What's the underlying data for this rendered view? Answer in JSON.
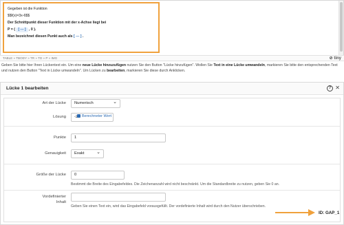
{
  "editor": {
    "line1": "Gegeben ist die Funktion",
    "line2": "$$f(x)=3x-6$$",
    "line3": "Der Schnittpunkt dieser Funktion mit der x-Achse liegt bei",
    "line4_prefix": "P = (",
    "line4_gap": "[ --- ]",
    "line4_suffix": ", 0 ).",
    "line5_prefix": "Man bezeichnet diesen Punkt auch als",
    "line5_gap": "[ --- ]",
    "line5_suffix": "."
  },
  "statusbar": {
    "path": "TABLE » TBODY » TR » TD » P » IMG",
    "brand": "tiny"
  },
  "help": {
    "text_a": "Geben Sie bitte hier Ihren Lückentext ein. Um eine ",
    "text_b": "neue Lücke hinzuzufügen",
    "text_c": " nutzen Sie den Button \"Lücke hinzufügen\". Wollen Sie ",
    "text_d": "Text in eine Lücke umwandeln",
    "text_e": ", markieren Sie bitte den entsprechenden Text und nutzen den Button \"Text in Lücke umwandeln\". Um Lücken zu ",
    "text_f": "bearbeiten",
    "text_g": ", markieren Sie diese durch Anklicken."
  },
  "panel": {
    "title": "Lücke 1 bearbeiten",
    "help_icon": "?",
    "close_icon": "✕"
  },
  "form": {
    "gap_type_label": "Art der Lücke",
    "gap_type_value": "Numerisch",
    "solution_label": "Lösung",
    "solution_value": "-2",
    "calc_link": "Berechneter Wert",
    "points_label": "Punkte",
    "points_value": "1",
    "precision_label": "Genauigkeit",
    "precision_value": "Exakt",
    "size_label": "Größe der Lücke",
    "size_value": "0",
    "size_hint": "Bestimmt die Breite des Eingabefeldes. Die Zeichenanzahl wird nicht beschränkt. Um die Standardbreite zu nutzen, geben Sie 0 an.",
    "predef_label_1": "Vordefinierter",
    "predef_label_2": "Inhalt",
    "predef_value": "",
    "predef_hint": "Geben Sie einen Text ein, wird das Eingabefeld vorausgefüllt. Der vordefinierte Inhalt wird durch den Nutzer überschrieben."
  },
  "gap_id": "ID: GAP_1",
  "colors": {
    "accent": "#f0a13c",
    "link": "#2a6ab3"
  }
}
